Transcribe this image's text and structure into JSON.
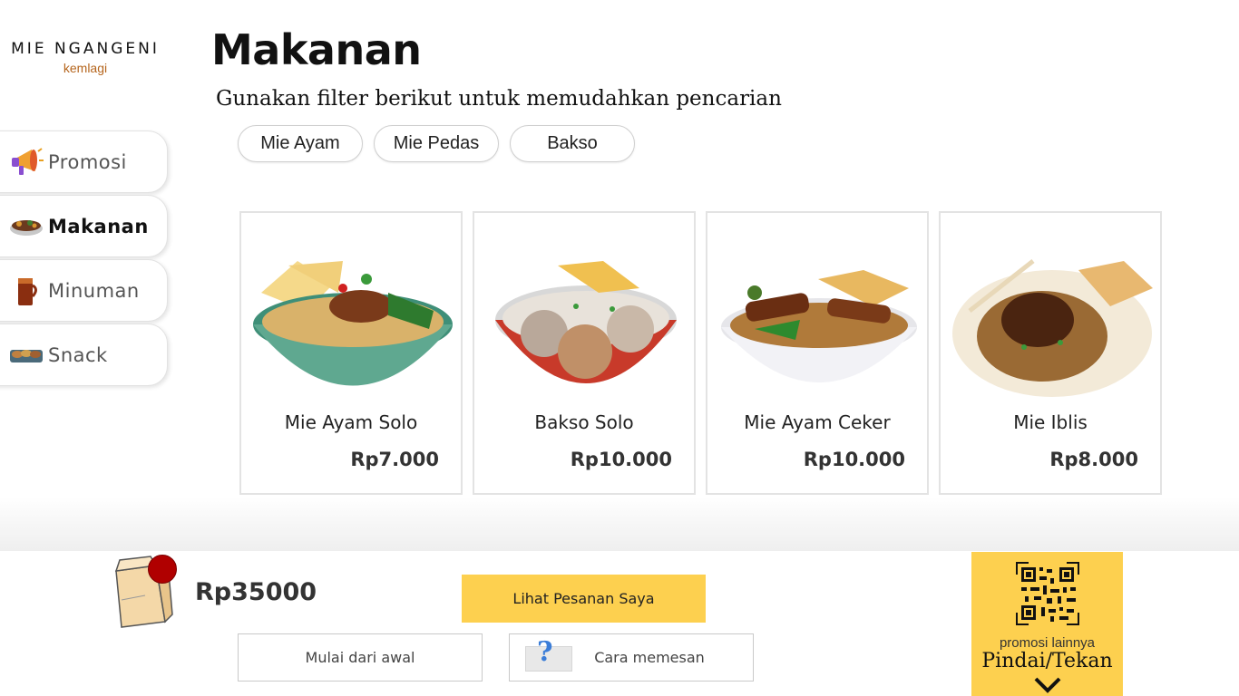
{
  "brand": {
    "name": "MIE NGANGENI",
    "location": "kemlagi"
  },
  "sidebar": {
    "items": [
      {
        "label": "Promosi",
        "icon": "megaphone-icon",
        "active": false
      },
      {
        "label": "Makanan",
        "icon": "food-bowl-icon",
        "active": true
      },
      {
        "label": "Minuman",
        "icon": "iced-tea-icon",
        "active": false
      },
      {
        "label": "Snack",
        "icon": "snack-plate-icon",
        "active": false
      }
    ]
  },
  "header": {
    "title": "Makanan",
    "subtitle": "Gunakan filter berikut untuk memudahkan pencarian"
  },
  "filters": [
    "Mie Ayam",
    "Mie Pedas",
    "Bakso"
  ],
  "products": [
    {
      "name": "Mie Ayam Solo",
      "price": "Rp7.000",
      "image": "mie-ayam-solo-image"
    },
    {
      "name": "Bakso Solo",
      "price": "Rp10.000",
      "image": "bakso-solo-image"
    },
    {
      "name": "Mie Ayam Ceker",
      "price": "Rp10.000",
      "image": "mie-ayam-ceker-image"
    },
    {
      "name": "Mie Iblis",
      "price": "Rp8.000",
      "image": "mie-iblis-image"
    }
  ],
  "cart": {
    "total": "Rp35000",
    "icon": "shopping-bag-icon"
  },
  "actions": {
    "view_order": "Lihat Pesanan Saya",
    "restart": "Mulai dari awal",
    "how_to_order": "Cara memesan"
  },
  "promo": {
    "subtitle": "promosi lainnya",
    "title": "Pindai/Tekan",
    "icon": "qr-code-icon"
  },
  "colors": {
    "accent": "#fdd04f",
    "badge": "#b00000",
    "brand_sub": "#b5651d"
  }
}
